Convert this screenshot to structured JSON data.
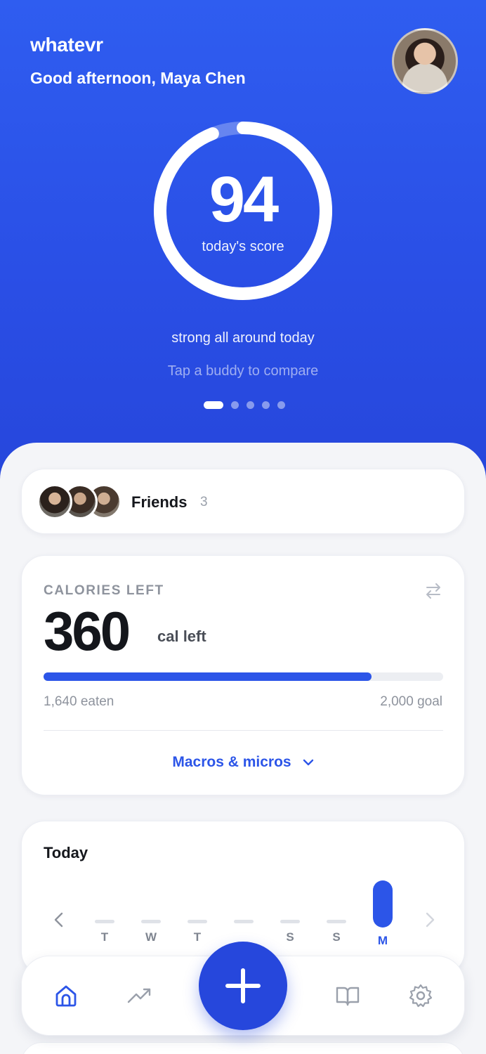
{
  "app": {
    "brand": "whatevr",
    "greeting": "Good afternoon, Maya Chen"
  },
  "score": {
    "value": "94",
    "label": "today's score",
    "progress": 0.94,
    "status": "strong all around today",
    "hint": "Tap a buddy to compare",
    "pager": {
      "pages": 5,
      "active_index": 0
    }
  },
  "friends": {
    "label": "Friends",
    "count": "3"
  },
  "calories": {
    "title": "CALORIES LEFT",
    "value": "360",
    "unit": "cal left",
    "eaten": "1,640 eaten",
    "goal": "2,000 goal",
    "progress": 0.82,
    "macros_label": "Macros & micros"
  },
  "today": {
    "title": "Today",
    "days": [
      "T",
      "W",
      "T",
      "",
      "S",
      "S",
      "M"
    ],
    "active_day_index": 6
  },
  "colors": {
    "accent": "#2c55e8",
    "hero": "#2a4fe6",
    "fab": "#2647dc"
  },
  "nav": {
    "items": [
      "home-icon",
      "trend-icon",
      "add-icon",
      "book-icon",
      "gear-icon"
    ],
    "active": "home-icon"
  }
}
